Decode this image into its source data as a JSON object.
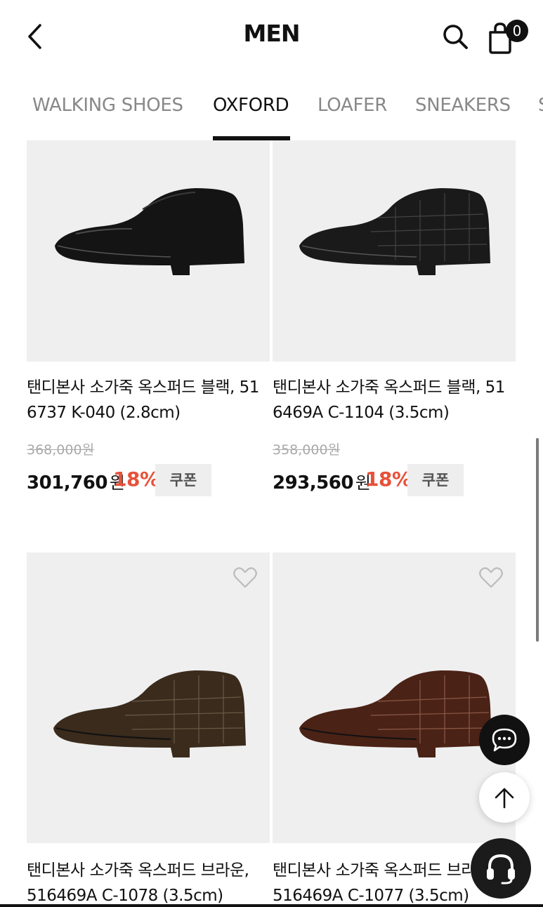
{
  "header": {
    "title": "MEN",
    "cart_count": "0",
    "icons": {
      "back": "chevron-left-icon",
      "search": "search-icon",
      "cart": "shopping-bag-icon"
    }
  },
  "tabs": [
    {
      "label": "WALKING SHOES",
      "active": false
    },
    {
      "label": "OXFORD",
      "active": true
    },
    {
      "label": "LOAFER",
      "active": false
    },
    {
      "label": "SNEAKERS",
      "active": false
    }
  ],
  "products": [
    {
      "name": "탠디본사 소가죽 옥스퍼드 블랙, 516737 K-040 (2.8cm)",
      "name_line1": "탠디본사 소가죽 옥스퍼드 블랙, 51",
      "name_line2": "6737 K-040 (2.8cm)",
      "original_price": "368,000원",
      "sale_price": "301,760",
      "currency": "원",
      "discount": "18%",
      "coupon_label": "쿠폰",
      "shoe_color": "#151515"
    },
    {
      "name": "탠디본사 소가죽 옥스퍼드 블랙, 516469A C-1104 (3.5cm)",
      "name_line1": "탠디본사 소가죽 옥스퍼드 블랙, 51",
      "name_line2": "6469A C-1104 (3.5cm)",
      "original_price": "358,000원",
      "sale_price": "293,560",
      "currency": "원",
      "discount": "18%",
      "coupon_label": "쿠폰",
      "shoe_color": "#1a1a1a"
    },
    {
      "name": "탠디본사 소가죽 옥스퍼드 브라운, 516469A C-1078 (3.5cm)",
      "name_line1": "탠디본사 소가죽 옥스퍼드 브라운,",
      "name_line2": "516469A C-1078 (3.5cm)",
      "shoe_color": "#3b2a1c"
    },
    {
      "name": "탠디본사 소가죽 옥스퍼드 브라운, 516469A C-1077 (3.5cm)",
      "name_line1": "탠디본사 소가죽 옥스퍼드 브라",
      "name_line2": "516469A C-1077 (3.5cm)",
      "shoe_color": "#4a2218"
    }
  ],
  "colors": {
    "discount": "#e8513a",
    "image_bg": "#efefef",
    "coupon_bg": "#eeeeee"
  },
  "floating_buttons": {
    "chat": "chat-bubble-icon",
    "scroll_top": "arrow-up-icon",
    "support": "headset-icon"
  }
}
